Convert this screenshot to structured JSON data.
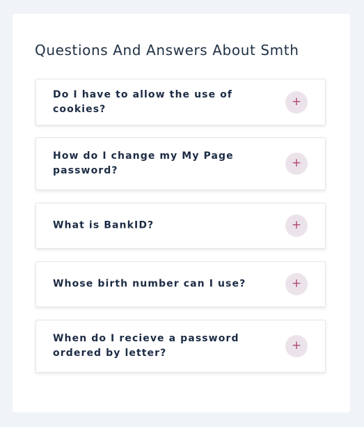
{
  "page": {
    "title": "Questions And Answers About Smth"
  },
  "faq": {
    "toggle_symbol": "+",
    "items": [
      {
        "question": "Do I have to allow the use of cookies?"
      },
      {
        "question": "How do I change my My Page password?"
      },
      {
        "question": "What is BankID?"
      },
      {
        "question": "Whose birth number can I use?"
      },
      {
        "question": "When do I recieve a password ordered by letter?"
      }
    ]
  },
  "colors": {
    "page_background": "#f0f4f8",
    "card_background": "#ffffff",
    "title_text": "#1f3044",
    "question_text": "#1c2b44",
    "toggle_background": "#ece3ea",
    "toggle_icon": "#b04870"
  }
}
